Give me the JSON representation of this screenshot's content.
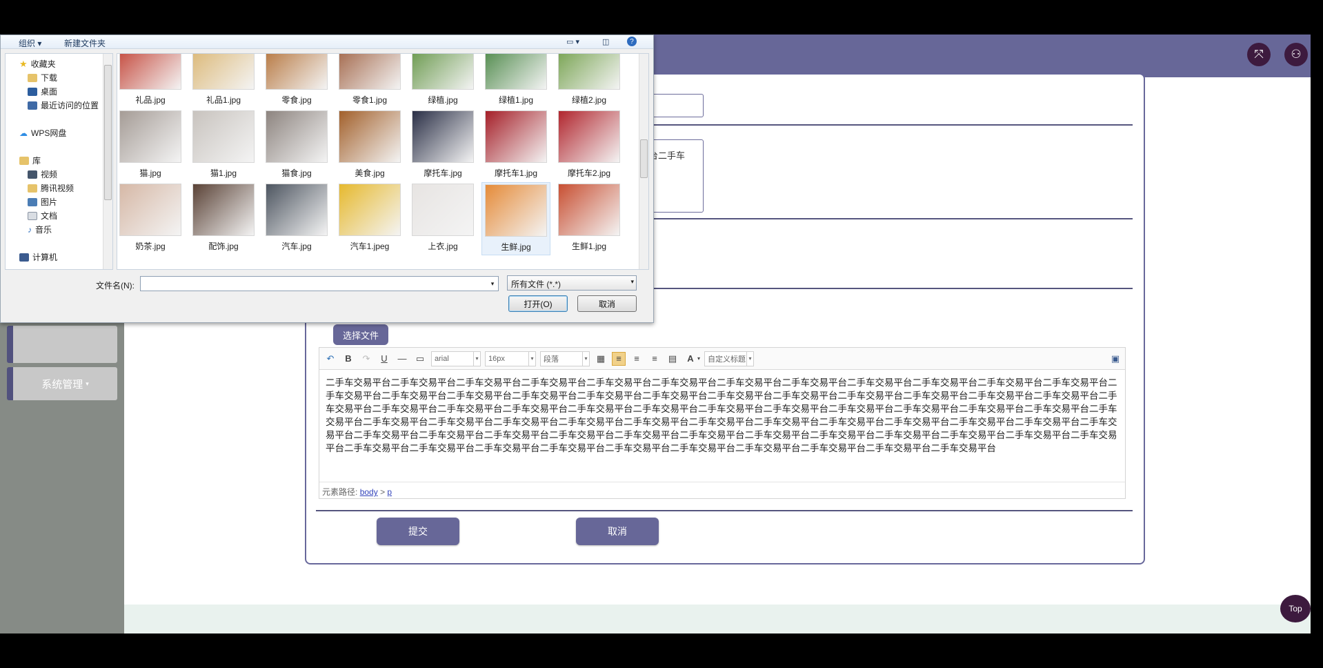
{
  "app": {
    "sidebar_menu": "系统管理",
    "editor_text": "二手车交易平台二手车交易平台二手车交易平台二手车交易平台二手车交易平台二手车交易平台二手车交易平台二手车交易平台二手车交易平台二手车交易平台二手车交易平台二手车交易平台二手车交易平台二手车交易平台二手车交易平台二手车交易平台二手车交易平台二手车交易平台二手车交易平台二手车交易平台二手车交易平台二手车交易平台二手车交易平台二手车交易平台二手车交易平台二手车交易平台二手车交易平台二手车交易平台二手车交易平台二手车交易平台二手车交易平台二手车交易平台二手车交易平台二手车交易平台二手车交易平台二手车交易平台二手车交易平台二手车交易平台二手车交易平台二手车交易平台二手车交易平台二手车交易平台二手车交易平台二手车交易平台二手车交易平台二手车交易平台二手车交易平台二手车交易平台二手车交易平台二手车交易平台二手车交易平台二手车交易平台二手车交易平台二手车交易平台二手车交易平台二手车交易平台二手车交易平台二手车交易平台二手车交易平台二手车交易平台二手车交易平台二手车交易平台二手车交易平台二手车交易平台二手车交易平台二手车交易平台二手车交易平台二手车交易平台二手车交易平台二手车交易平台二手车交易平台",
    "textarea_partial": "台二手车",
    "choose_file": "选择文件",
    "toolbar": {
      "font": "arial",
      "size": "16px",
      "paragraph": "段落",
      "custom_title": "自定义标题"
    },
    "path_label": "元素路径:",
    "path_body": "body",
    "path_sep": ">",
    "path_p": "p",
    "submit": "提交",
    "cancel": "取消",
    "top_button": "Top"
  },
  "dialog": {
    "organize": "组织 ▾",
    "new_folder": "新建文件夹",
    "nav": {
      "favorites": "收藏夹",
      "downloads": "下载",
      "desktop": "桌面",
      "recent": "最近访问的位置",
      "wps": "WPS网盘",
      "libraries": "库",
      "videos": "视频",
      "tencent_video": "腾讯视频",
      "pictures": "图片",
      "documents": "文档",
      "music": "音乐",
      "computer": "计算机"
    },
    "files": [
      "礼品.jpg",
      "礼品1.jpg",
      "零食.jpg",
      "零食1.jpg",
      "绿植.jpg",
      "绿植1.jpg",
      "绿植2.jpg",
      "猫.jpg",
      "猫1.jpg",
      "猫食.jpg",
      "美食.jpg",
      "摩托车.jpg",
      "摩托车1.jpg",
      "摩托车2.jpg",
      "奶茶.jpg",
      "配饰.jpg",
      "汽车.jpg",
      "汽车1.jpeg",
      "上衣.jpg",
      "生鲜.jpg",
      "生鲜1.jpg"
    ],
    "file_colors": [
      "#c0392b",
      "#d9b26a",
      "#b06a2d",
      "#9b5a3a",
      "#5b8f3b",
      "#3f7f3a",
      "#6a9a3f",
      "#a59c96",
      "#c8c3be",
      "#8d847f",
      "#a2602b",
      "#2a2f46",
      "#a51f28",
      "#b1262e",
      "#d6b8a6",
      "#5a4236",
      "#4d5560",
      "#e6b92e",
      "#e7e4e2",
      "#e58b39",
      "#c84f32"
    ],
    "filename_label": "文件名(N):",
    "filename_value": "",
    "filetype": "所有文件 (*.*)",
    "open_button": "打开(O)",
    "cancel_button": "取消"
  }
}
